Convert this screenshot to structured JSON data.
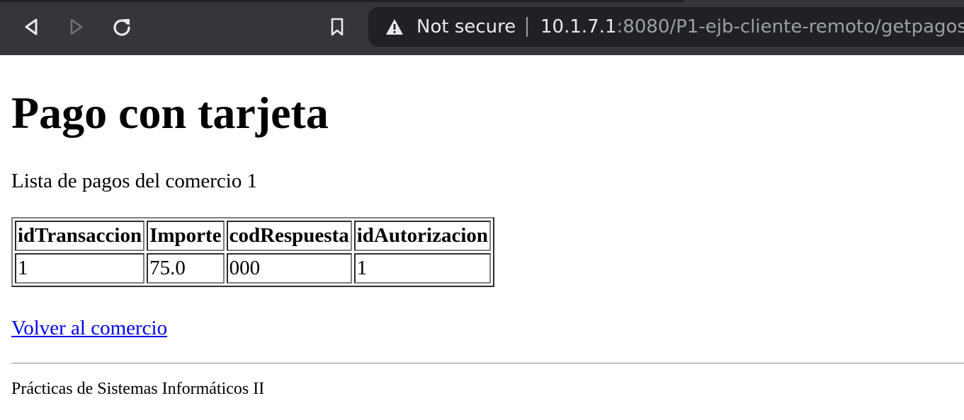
{
  "browser": {
    "security_label": "Not secure",
    "url_host": "10.1.7.1",
    "url_rest": ":8080/P1-ejb-cliente-remoto/getpagos",
    "icons": {
      "back": "back-arrow-icon",
      "forward": "forward-arrow-icon",
      "reload": "reload-icon",
      "bookmark": "bookmark-icon",
      "security": "warning-triangle-icon"
    },
    "colors": {
      "toolbar": "#35363a",
      "omnibox": "#202124",
      "text": "#e8eaed",
      "dim_text": "#9aa0a6"
    }
  },
  "page": {
    "title": "Pago con tarjeta",
    "subtitle": "Lista de pagos del comercio 1",
    "table": {
      "headers": [
        "idTransaccion",
        "Importe",
        "codRespuesta",
        "idAutorizacion"
      ],
      "rows": [
        [
          "1",
          "75.0",
          "000",
          "1"
        ]
      ]
    },
    "back_link": "Volver al comercio",
    "footer": "Prácticas de Sistemas Informáticos II",
    "colors": {
      "link": "#0000ee"
    }
  }
}
